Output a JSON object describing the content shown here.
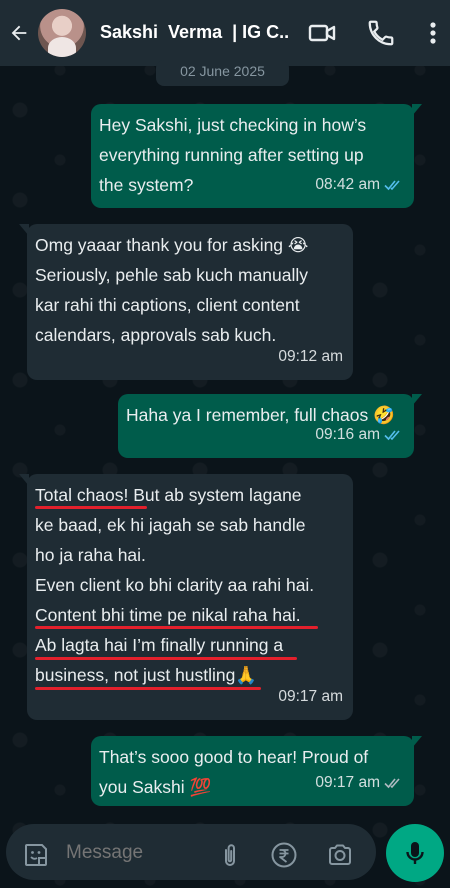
{
  "header": {
    "contact_name": "Sakshi  Verma  | IG C..",
    "icons": [
      "back-arrow-icon",
      "video-call-icon",
      "phone-icon",
      "more-vertical-icon"
    ]
  },
  "date_chip": "02 June 2025",
  "messages": [
    {
      "direction": "out",
      "text": "Hey Sakshi, just checking in how’s\neverything running after setting up\nthe system?",
      "time": "08:42 am",
      "ticks": "read"
    },
    {
      "direction": "in",
      "text": "Omg yaaar thank you for asking 😭\nSeriously, pehle sab kuch manually\nkar rahi thi captions, client content\ncalendars, approvals sab kuch.",
      "time": "09:12 am"
    },
    {
      "direction": "out",
      "text": "Haha ya I remember, full chaos 🤣",
      "time": "09:16 am",
      "ticks": "read"
    },
    {
      "direction": "in",
      "text": "Total chaos! But ab system lagane\nke baad, ek hi jagah se sab handle\nho ja raha hai.\nEven client ko bhi clarity aa rahi hai.\nContent bhi time pe nikal raha hai.\nAb lagta hai I’m finally running a\nbusiness, not just hustling🙏",
      "time": "09:17 am"
    },
    {
      "direction": "out",
      "text": "That’s sooo good to hear! Proud of\nyou Sakshi 💯",
      "time": "09:17 am",
      "ticks": "delivered"
    }
  ],
  "input": {
    "placeholder": "Message",
    "icons": [
      "emoji-sticker-icon",
      "attach-icon",
      "rupee-payment-icon",
      "camera-icon",
      "mic-icon"
    ]
  },
  "colors": {
    "outgoing_bubble": "#005c4b",
    "incoming_bubble": "#1f2c34",
    "header": "#1f2c34",
    "background": "#0b141a",
    "read_tick": "#53bdeb",
    "accent": "#00a884",
    "highlight_underline": "#e3202c"
  }
}
